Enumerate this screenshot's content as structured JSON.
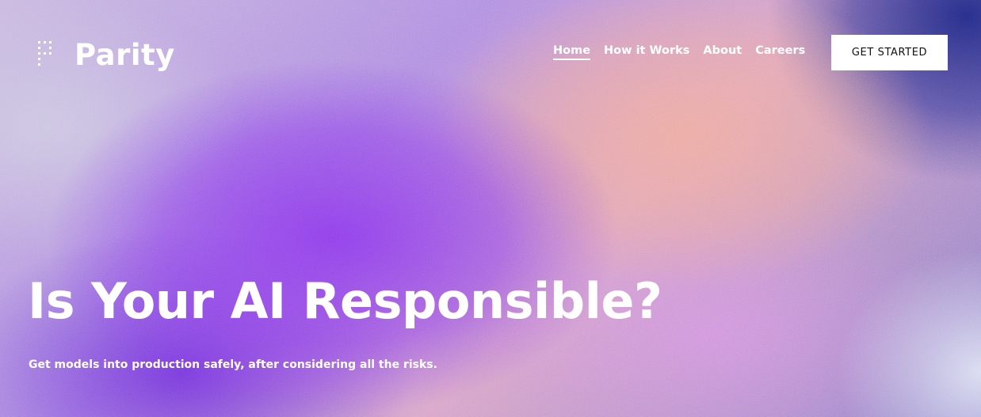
{
  "brand": {
    "name": "Parity",
    "logo_icon": "dot-grid-logo-icon"
  },
  "nav": {
    "items": [
      {
        "label": "Home",
        "active": true
      },
      {
        "label": "How it Works",
        "active": false
      },
      {
        "label": "About",
        "active": false
      },
      {
        "label": "Careers",
        "active": false
      }
    ],
    "cta_label": "GET STARTED"
  },
  "hero": {
    "headline": "Is Your AI Responsible?",
    "subtext": "Get models into production safely, after considering all the risks."
  },
  "colors": {
    "text": "#ffffff",
    "cta_background": "#ffffff",
    "cta_text": "#111111",
    "gradient_purple": "#8c3ceb",
    "gradient_peach": "#eeaaa0",
    "gradient_navy": "#1e2882"
  }
}
